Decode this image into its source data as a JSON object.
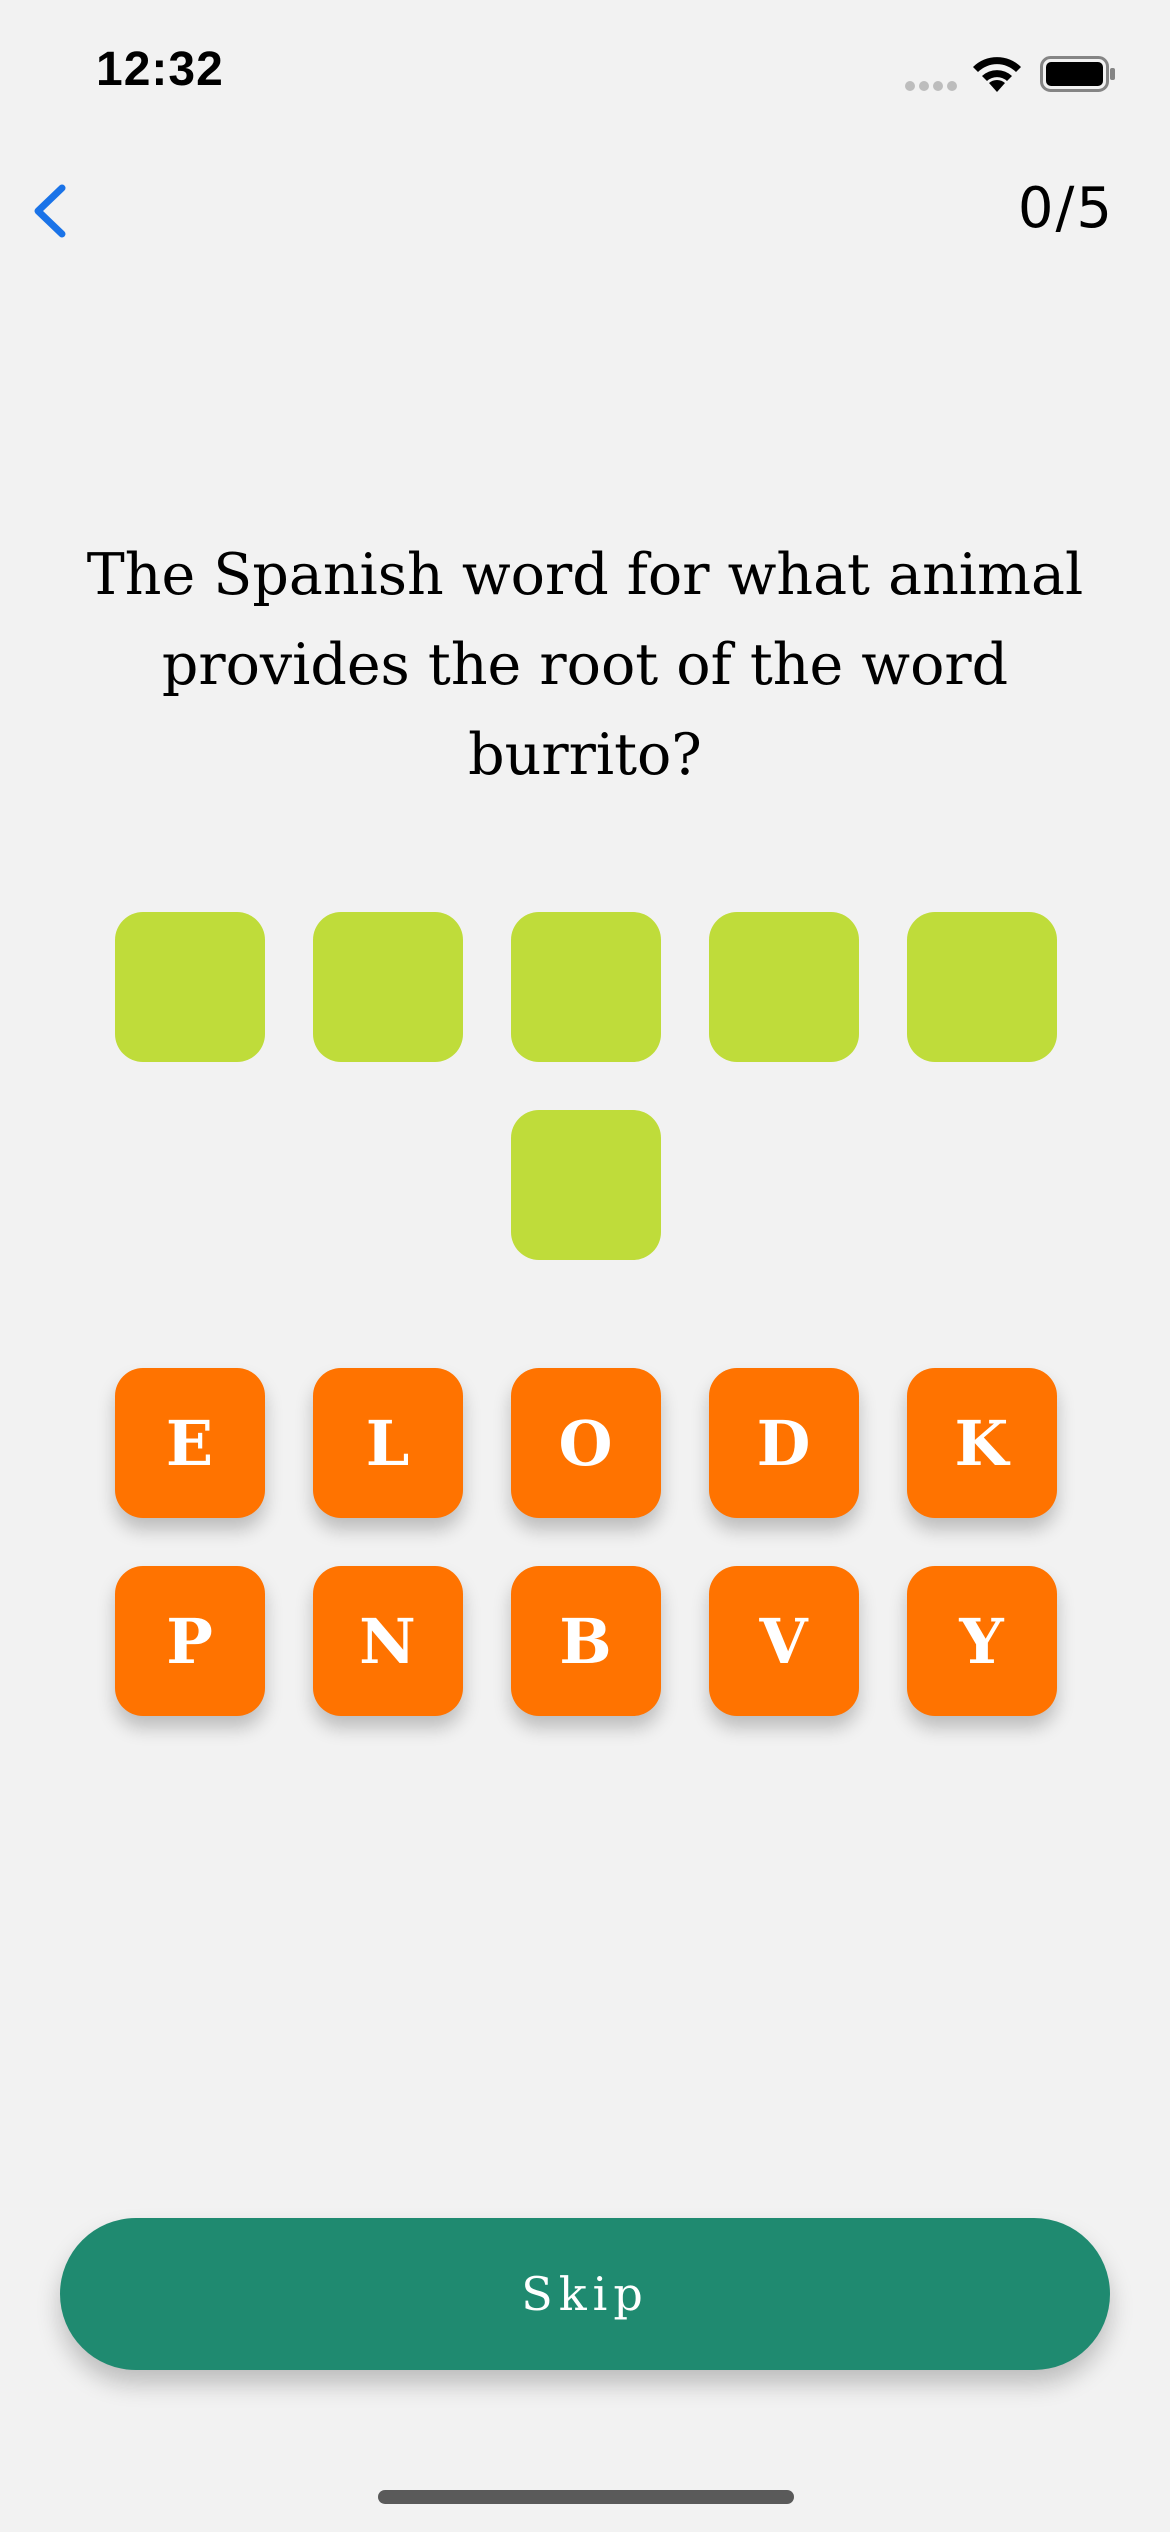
{
  "status_bar": {
    "time": "12:32",
    "icons": [
      "signal-dots-icon",
      "wifi-icon",
      "battery-icon"
    ]
  },
  "nav": {
    "back_icon": "chevron-left-icon",
    "progress": "0/5",
    "accent_color": "#1a73e8"
  },
  "question": {
    "text": "The Spanish word for what animal provides the root of the word burrito?"
  },
  "answer": {
    "slot_count": 6,
    "slots": [
      "",
      "",
      "",
      "",
      "",
      ""
    ],
    "slot_color": "#bfdc3a"
  },
  "letters": {
    "tile_color": "#ff7300",
    "items": [
      "E",
      "L",
      "O",
      "D",
      "K",
      "P",
      "N",
      "B",
      "V",
      "Y"
    ]
  },
  "skip": {
    "label": "Skip",
    "color": "#1f8a70"
  }
}
